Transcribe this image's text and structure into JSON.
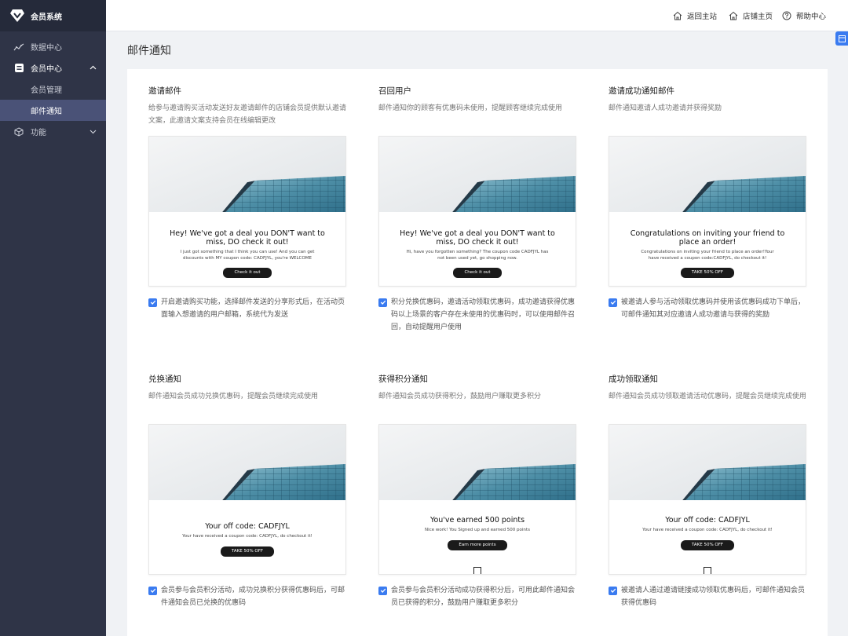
{
  "app": {
    "title": "会员系统"
  },
  "sidebar": {
    "items": [
      {
        "label": "数据中心"
      },
      {
        "label": "会员中心",
        "children": [
          {
            "label": "会员管理"
          },
          {
            "label": "邮件通知"
          }
        ]
      },
      {
        "label": "功能"
      }
    ]
  },
  "header": {
    "links": [
      {
        "label": "返回主站"
      },
      {
        "label": "店铺主页"
      },
      {
        "label": "帮助中心"
      }
    ]
  },
  "page": {
    "title": "邮件通知"
  },
  "cards": [
    {
      "title": "邀请邮件",
      "desc": "给参与邀请购买活动发送好友邀请邮件的店铺会员提供默认邀请文案，此邀请文案支持会员在线编辑更改",
      "preview": {
        "heading": "Hey! We've got a deal you DON'T want to miss, DO check it out!",
        "body": "I just got something that I think you can use! And you can get discounts with MY coupon code: CADFJYL, you're WELCOME",
        "button": "Check it out"
      },
      "option": "开启邀请购买功能，选择邮件发送的分享形式后，在活动页面输入想邀请的用户邮箱，系统代为发送"
    },
    {
      "title": "召回用户",
      "desc": "邮件通知你的顾客有优惠码未使用，提醒顾客继续完成使用",
      "preview": {
        "heading": "Hey! We've got a deal you DON'T want to miss, DO check it out!",
        "body": "Hi, have you forgotten something? The coupon code CADFJYL has not been used yet, go shopping now.",
        "button": "Check it out"
      },
      "option": "积分兑换优惠码，邀请活动领取优惠码，成功邀请获得优惠码以上场景的客户存在未使用的优惠码时，可以使用邮件召回，自动提醒用户使用"
    },
    {
      "title": "邀请成功通知邮件",
      "desc": "邮件通知邀请人成功邀请并获得奖励",
      "preview": {
        "heading": "Congratulations on inviting your friend to place an order!",
        "body": "Congratulations on inviting your friend to place an order!Your have received a coupon code:CADFJYL, do checkout it!",
        "button": "TAKE 50% OFF"
      },
      "option": "被邀请人参与活动领取优惠码并使用该优惠码成功下单后，可邮件通知其对应邀请人成功邀请与获得的奖励"
    },
    {
      "title": "兑换通知",
      "desc": "邮件通知会员成功兑换优惠码，提醒会员继续完成使用",
      "preview": {
        "heading": "Your off code: CADFJYL",
        "body": "Your have received a coupon code: CADFJYL, do checkout it!",
        "button": "TAKE 50% OFF"
      },
      "option": "会员参与会员积分活动，成功兑换积分获得优惠码后，可邮件通知会员已兑换的优惠码"
    },
    {
      "title": "获得积分通知",
      "desc": "邮件通知会员成功获得积分，鼓励用户赚取更多积分",
      "preview": {
        "heading": "You've earned 500 points",
        "body": "Nice work!  You Signed up and earned 500 points",
        "button": "Earn more points"
      },
      "option": "会员参与会员积分活动成功获得积分后，可用此邮件通知会员已获得的积分，鼓励用户赚取更多积分"
    },
    {
      "title": "成功领取通知",
      "desc": "邮件通知会员成功领取邀请活动优惠码，提醒会员继续完成使用",
      "preview": {
        "heading": "Your off code: CADFJYL",
        "body": "Your have received a coupon code: CADFJYL, do checkout it!",
        "button": "TAKE 50% OFF"
      },
      "option": "被邀请人通过邀请链接成功领取优惠码后，可邮件通知会员获得优惠码"
    }
  ]
}
